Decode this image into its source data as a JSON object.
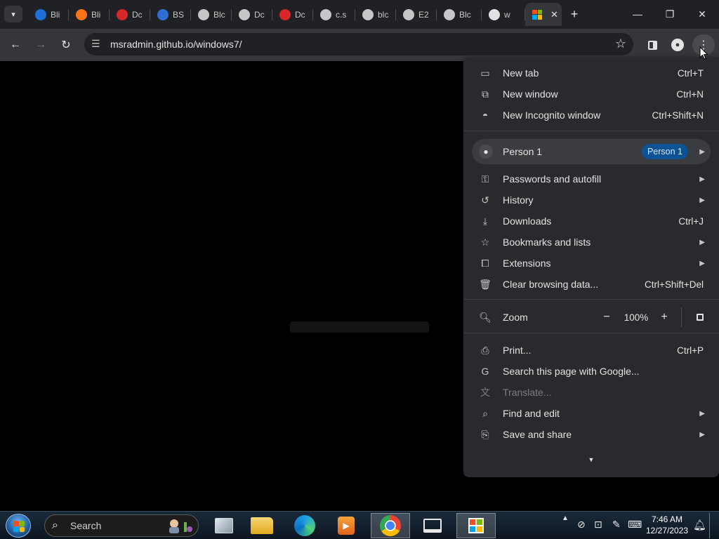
{
  "tabs": [
    {
      "label": "Bli",
      "favicon_color": "#1e6fd9"
    },
    {
      "label": "Bli",
      "favicon_color": "#f97316"
    },
    {
      "label": "Dc",
      "favicon_color": "#d62828"
    },
    {
      "label": "BS",
      "favicon_color": "#2f6fd1"
    },
    {
      "label": "Blc",
      "favicon_color": "#c4c7c5"
    },
    {
      "label": "Dc",
      "favicon_color": "#c4c7c5"
    },
    {
      "label": "Dc",
      "favicon_color": "#d62828"
    },
    {
      "label": "c.s",
      "favicon_color": "#c4c7c5"
    },
    {
      "label": "blc",
      "favicon_color": "#c4c7c5"
    },
    {
      "label": "E2",
      "favicon_color": "#c4c7c5"
    },
    {
      "label": "Blc",
      "favicon_color": "#c4c7c5"
    },
    {
      "label": "w",
      "favicon_color": "#e3e3e3"
    }
  ],
  "active_tab": {
    "favicon": "windows-flag-icon"
  },
  "address_bar": {
    "url": "msradmin.github.io/windows7/"
  },
  "menu": {
    "group1": [
      {
        "icon": "new-tab-icon",
        "label": "New tab",
        "shortcut": "Ctrl+T"
      },
      {
        "icon": "new-window-icon",
        "label": "New window",
        "shortcut": "Ctrl+N"
      },
      {
        "icon": "incognito-icon",
        "label": "New Incognito window",
        "shortcut": "Ctrl+Shift+N"
      }
    ],
    "profile": {
      "label": "Person 1",
      "badge": "Person 1"
    },
    "group2": [
      {
        "icon": "key-icon",
        "label": "Passwords and autofill",
        "shortcut": "",
        "submenu": true
      },
      {
        "icon": "history-icon",
        "label": "History",
        "shortcut": "",
        "submenu": true
      },
      {
        "icon": "download-icon",
        "label": "Downloads",
        "shortcut": "Ctrl+J",
        "submenu": false
      },
      {
        "icon": "star-icon",
        "label": "Bookmarks and lists",
        "shortcut": "",
        "submenu": true
      },
      {
        "icon": "extension-icon",
        "label": "Extensions",
        "shortcut": "",
        "submenu": true
      },
      {
        "icon": "trash-icon",
        "label": "Clear browsing data...",
        "shortcut": "Ctrl+Shift+Del",
        "submenu": false
      }
    ],
    "zoom": {
      "label": "Zoom",
      "value": "100%",
      "minus": "−",
      "plus": "+"
    },
    "group3": [
      {
        "icon": "print-icon",
        "label": "Print...",
        "shortcut": "Ctrl+P",
        "submenu": false,
        "disabled": false
      },
      {
        "icon": "google-icon",
        "label": "Search this page with Google...",
        "shortcut": "",
        "submenu": false,
        "disabled": false
      },
      {
        "icon": "translate-icon",
        "label": "Translate...",
        "shortcut": "",
        "submenu": false,
        "disabled": true
      },
      {
        "icon": "find-icon",
        "label": "Find and edit",
        "shortcut": "",
        "submenu": true,
        "disabled": false
      },
      {
        "icon": "save-share-icon",
        "label": "Save and share",
        "shortcut": "",
        "submenu": true,
        "disabled": false
      }
    ]
  },
  "taskbar": {
    "search_label": "Search",
    "clock_time": "7:46 AM",
    "clock_date": "12/27/2023"
  },
  "colors": {
    "accent": "#0b5394",
    "menu_bg": "#292a2d",
    "toolbar_bg": "#35363a"
  }
}
